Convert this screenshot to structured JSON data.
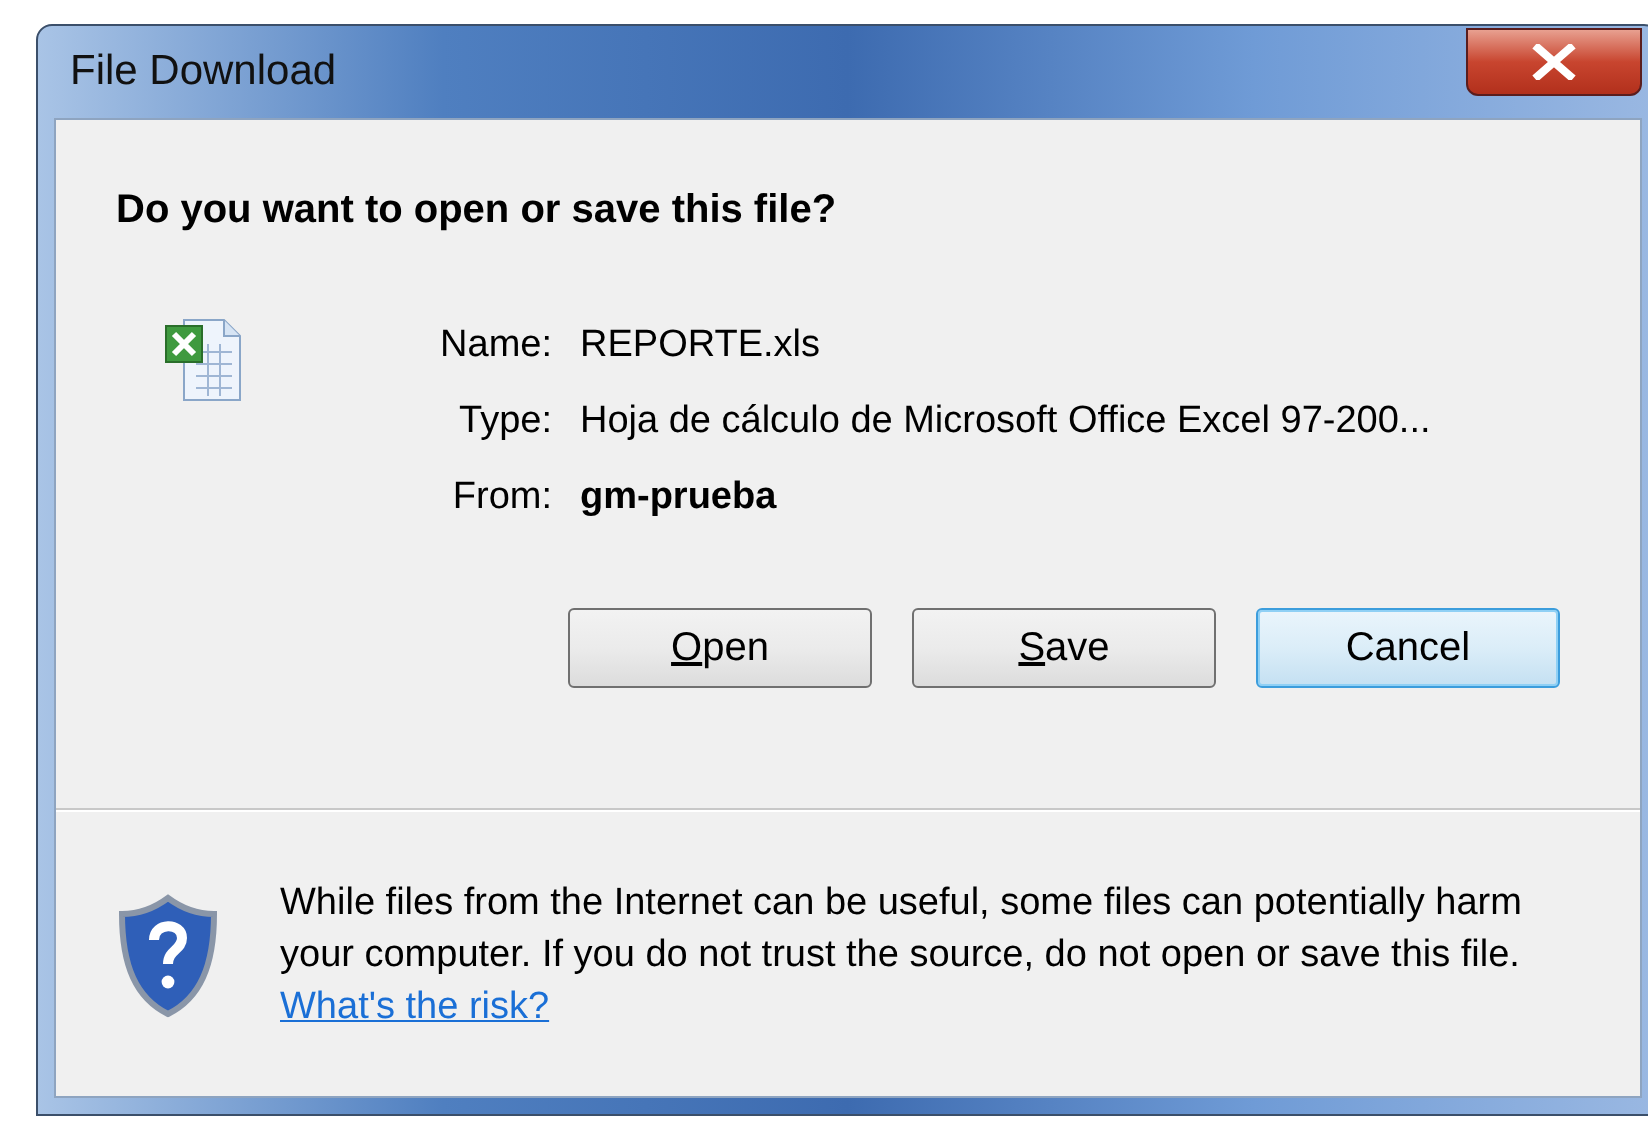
{
  "window": {
    "title": "File Download"
  },
  "heading": "Do you want to open or save this file?",
  "file": {
    "fields": [
      {
        "label": "Name:",
        "value": "REPORTE.xls",
        "bold": false
      },
      {
        "label": "Type:",
        "value": "Hoja de cálculo de Microsoft Office Excel 97-200...",
        "bold": false
      },
      {
        "label": "From:",
        "value": "gm-prueba",
        "bold": true
      }
    ]
  },
  "buttons": [
    {
      "label": "Open",
      "mnemonic": true,
      "default": false
    },
    {
      "label": "Save",
      "mnemonic": true,
      "default": false
    },
    {
      "label": "Cancel",
      "mnemonic": false,
      "default": true
    }
  ],
  "warning": {
    "text": "While files from the Internet can be useful, some files can potentially harm your computer. If you do not trust the source, do not open or save this file.",
    "link": "What's the risk?"
  }
}
